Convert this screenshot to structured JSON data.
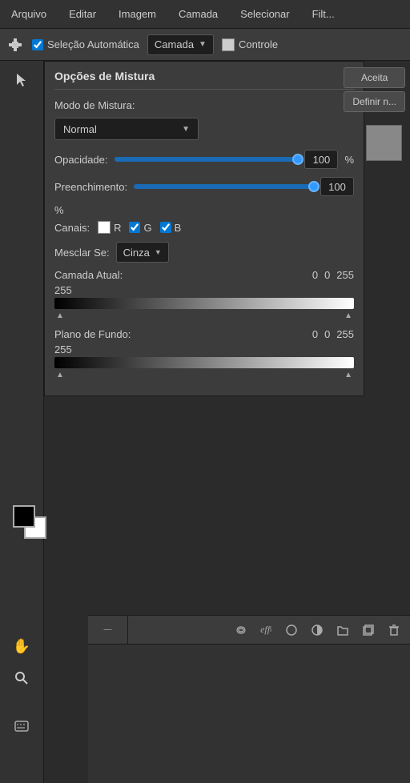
{
  "menubar": {
    "items": [
      "Arquivo",
      "Editar",
      "Imagem",
      "Camada",
      "Selecionar",
      "Filt..."
    ]
  },
  "toolbar": {
    "auto_select_label": "Seleção Automática",
    "auto_select_checked": true,
    "dropdown_label": "Camada",
    "control_label": "Controle"
  },
  "blend_panel": {
    "title": "Opções de Mistura",
    "blend_mode_label": "Modo de Mistura:",
    "blend_mode_value": "Normal",
    "opacity_label": "Opacidade:",
    "opacity_value": "100",
    "opacity_unit": "%",
    "fill_label": "Preenchimento:",
    "fill_value": "100",
    "fill_unit": "%",
    "channels_label": "Canais:",
    "channel_r": "R",
    "channel_g": "G",
    "channel_b": "B",
    "blend_if_label": "Mesclar Se:",
    "blend_if_value": "Cinza",
    "current_layer_label": "Camada Atual:",
    "current_layer_v1": "0",
    "current_layer_v2": "0",
    "current_layer_v3": "255",
    "current_layer_v4": "255",
    "background_label": "Plano de Fundo:",
    "background_v1": "0",
    "background_v2": "0",
    "background_v3": "255",
    "background_v4": "255"
  },
  "side_buttons": {
    "accept": "Aceita",
    "define": "Definir n..."
  },
  "layers_toolbar": {
    "icons": [
      "link",
      "fx",
      "circle",
      "half-circle",
      "folder",
      "rectangle",
      "trash"
    ]
  },
  "tools": {
    "move": "✥",
    "hand": "✋",
    "zoom": "🔍",
    "keyboard": "⌨"
  }
}
